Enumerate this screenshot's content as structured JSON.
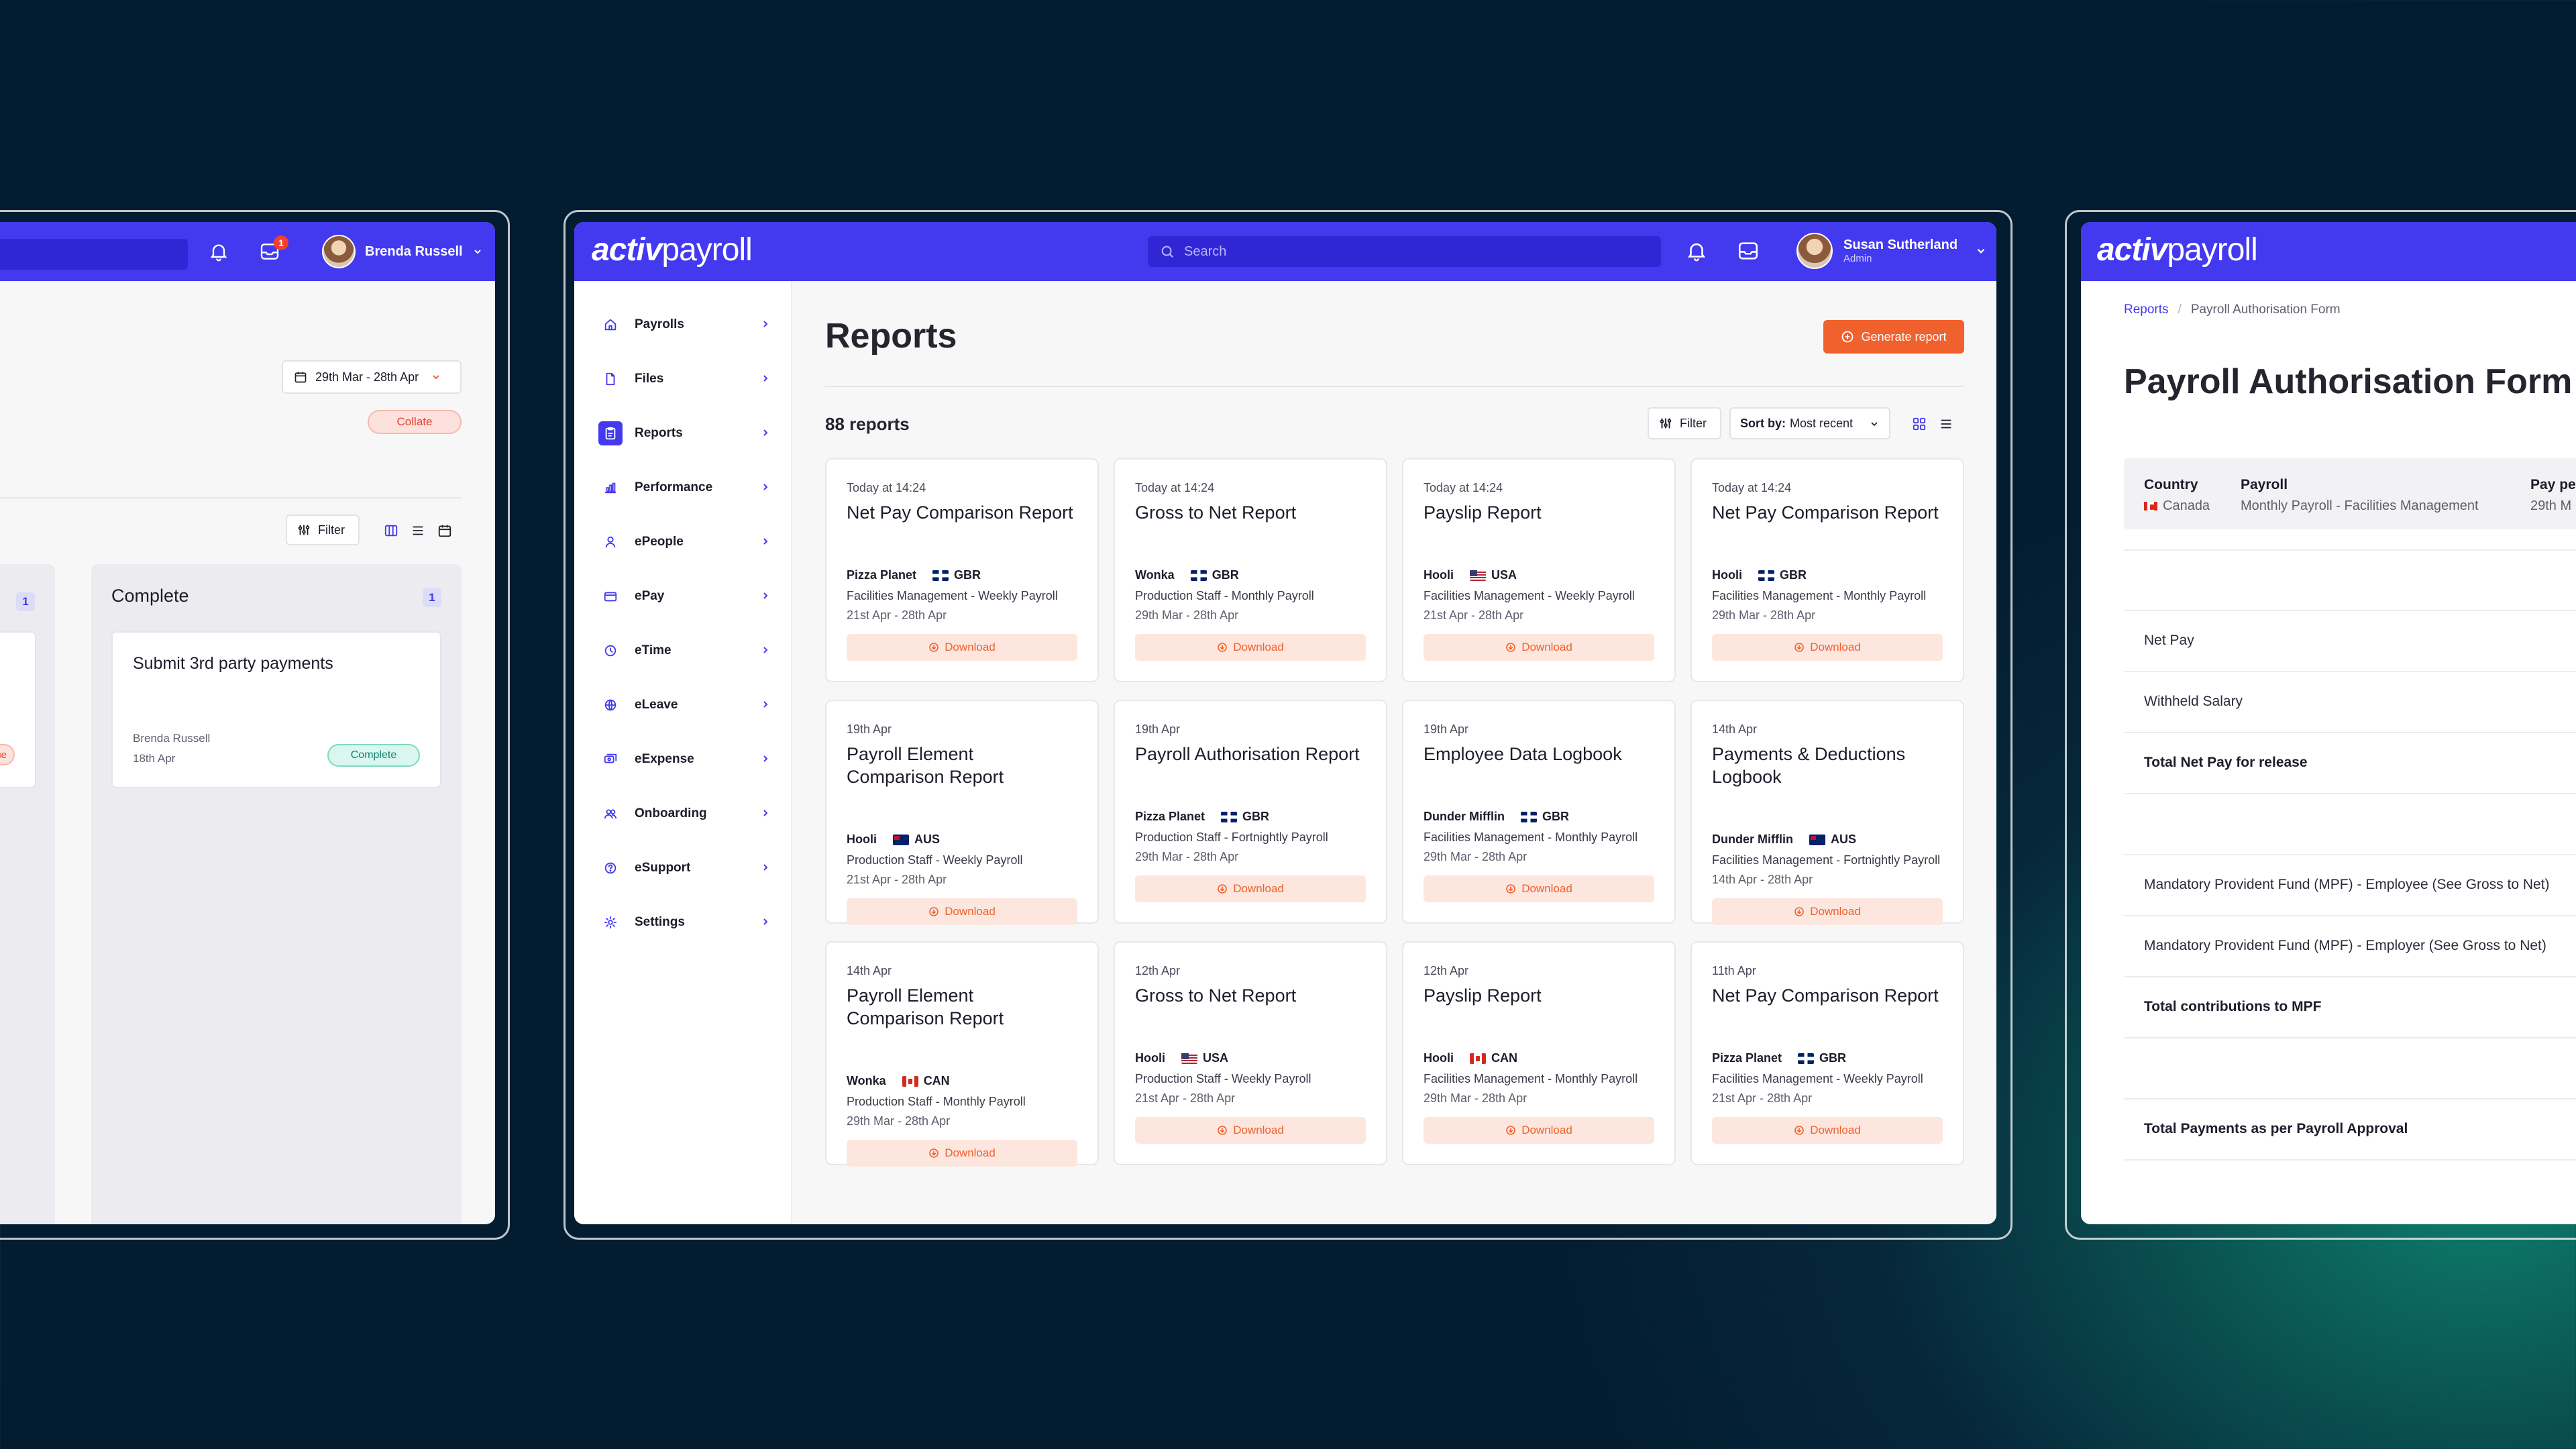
{
  "left_window": {
    "user_name": "Brenda Russell",
    "notification_count": "1",
    "date_range": "29th Mar - 28th Apr",
    "collate_label": "Collate",
    "filter_label": "Filter",
    "column_count_partial": "1",
    "overdue_partial": "rdue",
    "complete_column": {
      "title": "Complete",
      "count": "1",
      "task_title": "Submit 3rd party payments",
      "assignee": "Brenda Russell",
      "date": "18th Apr",
      "status": "Complete"
    }
  },
  "main_window": {
    "logo_bold": "activ",
    "logo_regular": "payroll",
    "search_placeholder": "Search",
    "user_name": "Susan Sutherland",
    "user_role": "Admin",
    "nav": [
      {
        "label": "Payrolls",
        "icon": "home-icon"
      },
      {
        "label": "Files",
        "icon": "files-icon"
      },
      {
        "label": "Reports",
        "icon": "reports-icon"
      },
      {
        "label": "Performance",
        "icon": "chart-icon"
      },
      {
        "label": "ePeople",
        "icon": "people-icon"
      },
      {
        "label": "ePay",
        "icon": "card-icon"
      },
      {
        "label": "eTime",
        "icon": "clock-icon"
      },
      {
        "label": "eLeave",
        "icon": "globe-icon"
      },
      {
        "label": "eExpense",
        "icon": "expense-icon"
      },
      {
        "label": "Onboarding",
        "icon": "onboarding-icon"
      },
      {
        "label": "eSupport",
        "icon": "help-icon"
      },
      {
        "label": "Settings",
        "icon": "gear-icon"
      }
    ],
    "page_title": "Reports",
    "generate_label": "Generate report",
    "report_count": "88 reports",
    "filter_label": "Filter",
    "sort_prefix": "Sort by:",
    "sort_value": "Most recent",
    "download_label": "Download",
    "reports": [
      {
        "when": "Today at 14:24",
        "title": "Net Pay Comparison Report",
        "client": "Pizza Planet",
        "country": "GBR",
        "flag": "gbr",
        "payroll": "Facilities Management - Weekly Payroll",
        "dates": "21st Apr - 28th Apr"
      },
      {
        "when": "Today at 14:24",
        "title": "Gross to Net Report",
        "client": "Wonka",
        "country": "GBR",
        "flag": "gbr",
        "payroll": "Production Staff - Monthly Payroll",
        "dates": "29th Mar - 28th Apr"
      },
      {
        "when": "Today at 14:24",
        "title": "Payslip Report",
        "client": "Hooli",
        "country": "USA",
        "flag": "usa",
        "payroll": "Facilities Management - Weekly Payroll",
        "dates": "21st Apr - 28th Apr"
      },
      {
        "when": "Today at 14:24",
        "title": "Net Pay Comparison Report",
        "client": "Hooli",
        "country": "GBR",
        "flag": "gbr",
        "payroll": "Facilities Management - Monthly Payroll",
        "dates": "29th Mar - 28th Apr"
      },
      {
        "when": "19th Apr",
        "title": "Payroll Element Comparison Report",
        "client": "Hooli",
        "country": "AUS",
        "flag": "aus",
        "payroll": "Production Staff - Weekly Payroll",
        "dates": "21st Apr - 28th Apr"
      },
      {
        "when": "19th Apr",
        "title": "Payroll Authorisation Report",
        "client": "Pizza Planet",
        "country": "GBR",
        "flag": "gbr",
        "payroll": "Production Staff - Fortnightly Payroll",
        "dates": "29th Mar - 28th Apr"
      },
      {
        "when": "19th Apr",
        "title": "Employee Data Logbook",
        "client": "Dunder Mifflin",
        "country": "GBR",
        "flag": "gbr",
        "payroll": "Facilities Management - Monthly Payroll",
        "dates": "29th Mar - 28th Apr"
      },
      {
        "when": "14th Apr",
        "title": "Payments & Deductions Logbook",
        "client": "Dunder Mifflin",
        "country": "AUS",
        "flag": "aus",
        "payroll": "Facilities Management - Fortnightly Payroll",
        "dates": "14th Apr - 28th Apr"
      },
      {
        "when": "14th Apr",
        "title": "Payroll Element Comparison Report",
        "client": "Wonka",
        "country": "CAN",
        "flag": "can",
        "payroll": "Production Staff - Monthly Payroll",
        "dates": "29th Mar - 28th Apr"
      },
      {
        "when": "12th Apr",
        "title": "Gross to Net Report",
        "client": "Hooli",
        "country": "USA",
        "flag": "usa",
        "payroll": "Production Staff - Weekly Payroll",
        "dates": "21st Apr - 28th Apr"
      },
      {
        "when": "12th Apr",
        "title": "Payslip Report",
        "client": "Hooli",
        "country": "CAN",
        "flag": "can",
        "payroll": "Facilities Management - Monthly Payroll",
        "dates": "29th Mar - 28th Apr"
      },
      {
        "when": "11th Apr",
        "title": "Net Pay Comparison Report",
        "client": "Pizza Planet",
        "country": "GBR",
        "flag": "gbr",
        "payroll": "Facilities Management - Weekly Payroll",
        "dates": "21st Apr - 28th Apr"
      }
    ]
  },
  "right_window": {
    "logo_bold": "activ",
    "logo_regular": "payroll",
    "breadcrumb_root": "Reports",
    "breadcrumb_current": "Payroll Authorisation Form",
    "title": "Payroll Authorisation Form",
    "meta": {
      "country_label": "Country",
      "country_value": "Canada",
      "payroll_label": "Payroll",
      "payroll_value": "Monthly Payroll - Facilities Management",
      "period_label": "Pay per",
      "period_value": "29th M"
    },
    "rows": [
      {
        "label": "",
        "bold": false
      },
      {
        "label": "Net Pay",
        "bold": false
      },
      {
        "label": "Withheld Salary",
        "bold": false
      },
      {
        "label": "Total Net Pay for release",
        "bold": true
      },
      {
        "label": "",
        "bold": false
      },
      {
        "label": "Mandatory Provident Fund (MPF) - Employee (See Gross to Net)",
        "bold": false
      },
      {
        "label": "Mandatory Provident Fund (MPF) - Employer (See Gross to Net)",
        "bold": false
      },
      {
        "label": "Total contributions to MPF",
        "bold": true
      },
      {
        "label": "",
        "bold": false
      },
      {
        "label": "Total Payments as per Payroll Approval",
        "bold": true
      },
      {
        "label": "",
        "bold": false
      }
    ]
  }
}
